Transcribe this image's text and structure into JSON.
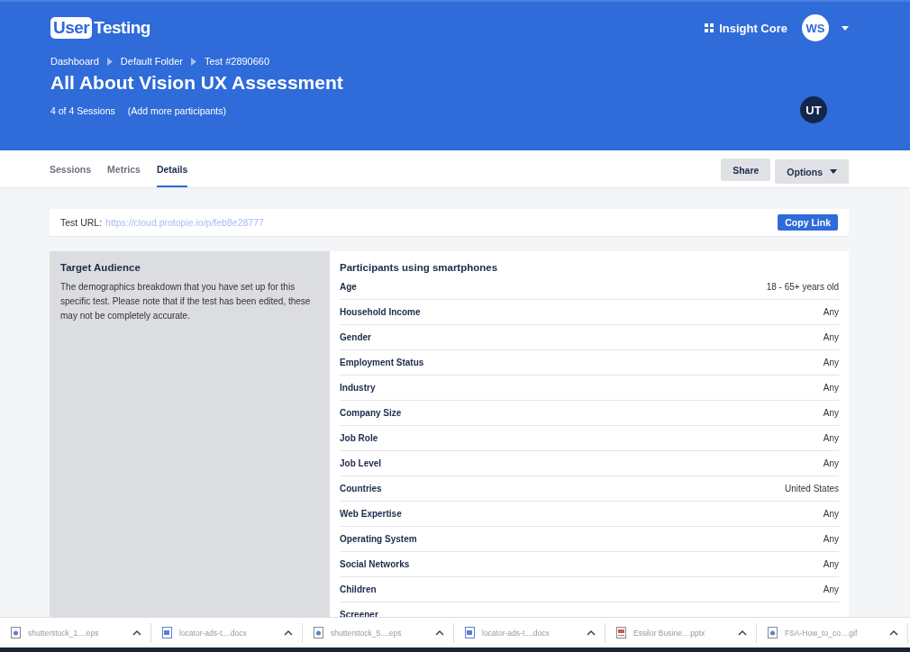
{
  "header": {
    "brand": {
      "part1": "User",
      "part2": "Testing"
    },
    "workspace": "Insight Core",
    "user_initials": "WS",
    "breadcrumb": [
      "Dashboard",
      "Default Folder",
      "Test #2890660"
    ],
    "title": "All About Vision UX Assessment",
    "sessions": "4 of 4 Sessions",
    "add_link": "(Add more participants)",
    "owner_initials": "UT"
  },
  "tabs": [
    {
      "label": "Sessions",
      "selected": false
    },
    {
      "label": "Metrics",
      "selected": false
    },
    {
      "label": "Details",
      "selected": true
    }
  ],
  "actions": {
    "share": "Share",
    "options": "Options"
  },
  "test_url": {
    "label": "Test URL:",
    "url": "https://cloud.protopie.io/p/feb8e28777",
    "button": "Copy Link"
  },
  "audience": {
    "title": "Target Audience",
    "description": "The demographics breakdown that you have set up for this specific test. Please note that if the test has been edited, these may not be completely accurate."
  },
  "participants": {
    "title": "Participants using smartphones",
    "rows": [
      {
        "label": "Age",
        "value": "18 - 65+ years old"
      },
      {
        "label": "Household Income",
        "value": "Any"
      },
      {
        "label": "Gender",
        "value": "Any"
      },
      {
        "label": "Employment Status",
        "value": "Any"
      },
      {
        "label": "Industry",
        "value": "Any"
      },
      {
        "label": "Company Size",
        "value": "Any"
      },
      {
        "label": "Job Role",
        "value": "Any"
      },
      {
        "label": "Job Level",
        "value": "Any"
      },
      {
        "label": "Countries",
        "value": "United States"
      },
      {
        "label": "Web Expertise",
        "value": "Any"
      },
      {
        "label": "Operating System",
        "value": "Any"
      },
      {
        "label": "Social Networks",
        "value": "Any"
      },
      {
        "label": "Children",
        "value": "Any"
      },
      {
        "label": "Screener"
      }
    ]
  },
  "downloads": [
    {
      "name": "shutterstock_1....eps",
      "kind": "image"
    },
    {
      "name": "locator-ads-t....docx",
      "kind": "doc"
    },
    {
      "name": "shutterstock_5....eps",
      "kind": "image"
    },
    {
      "name": "locator-ads-t....docx",
      "kind": "doc"
    },
    {
      "name": "Essilor Busine....pptx",
      "kind": "slides"
    },
    {
      "name": "FSA-How_to_co....gif",
      "kind": "image"
    }
  ]
}
